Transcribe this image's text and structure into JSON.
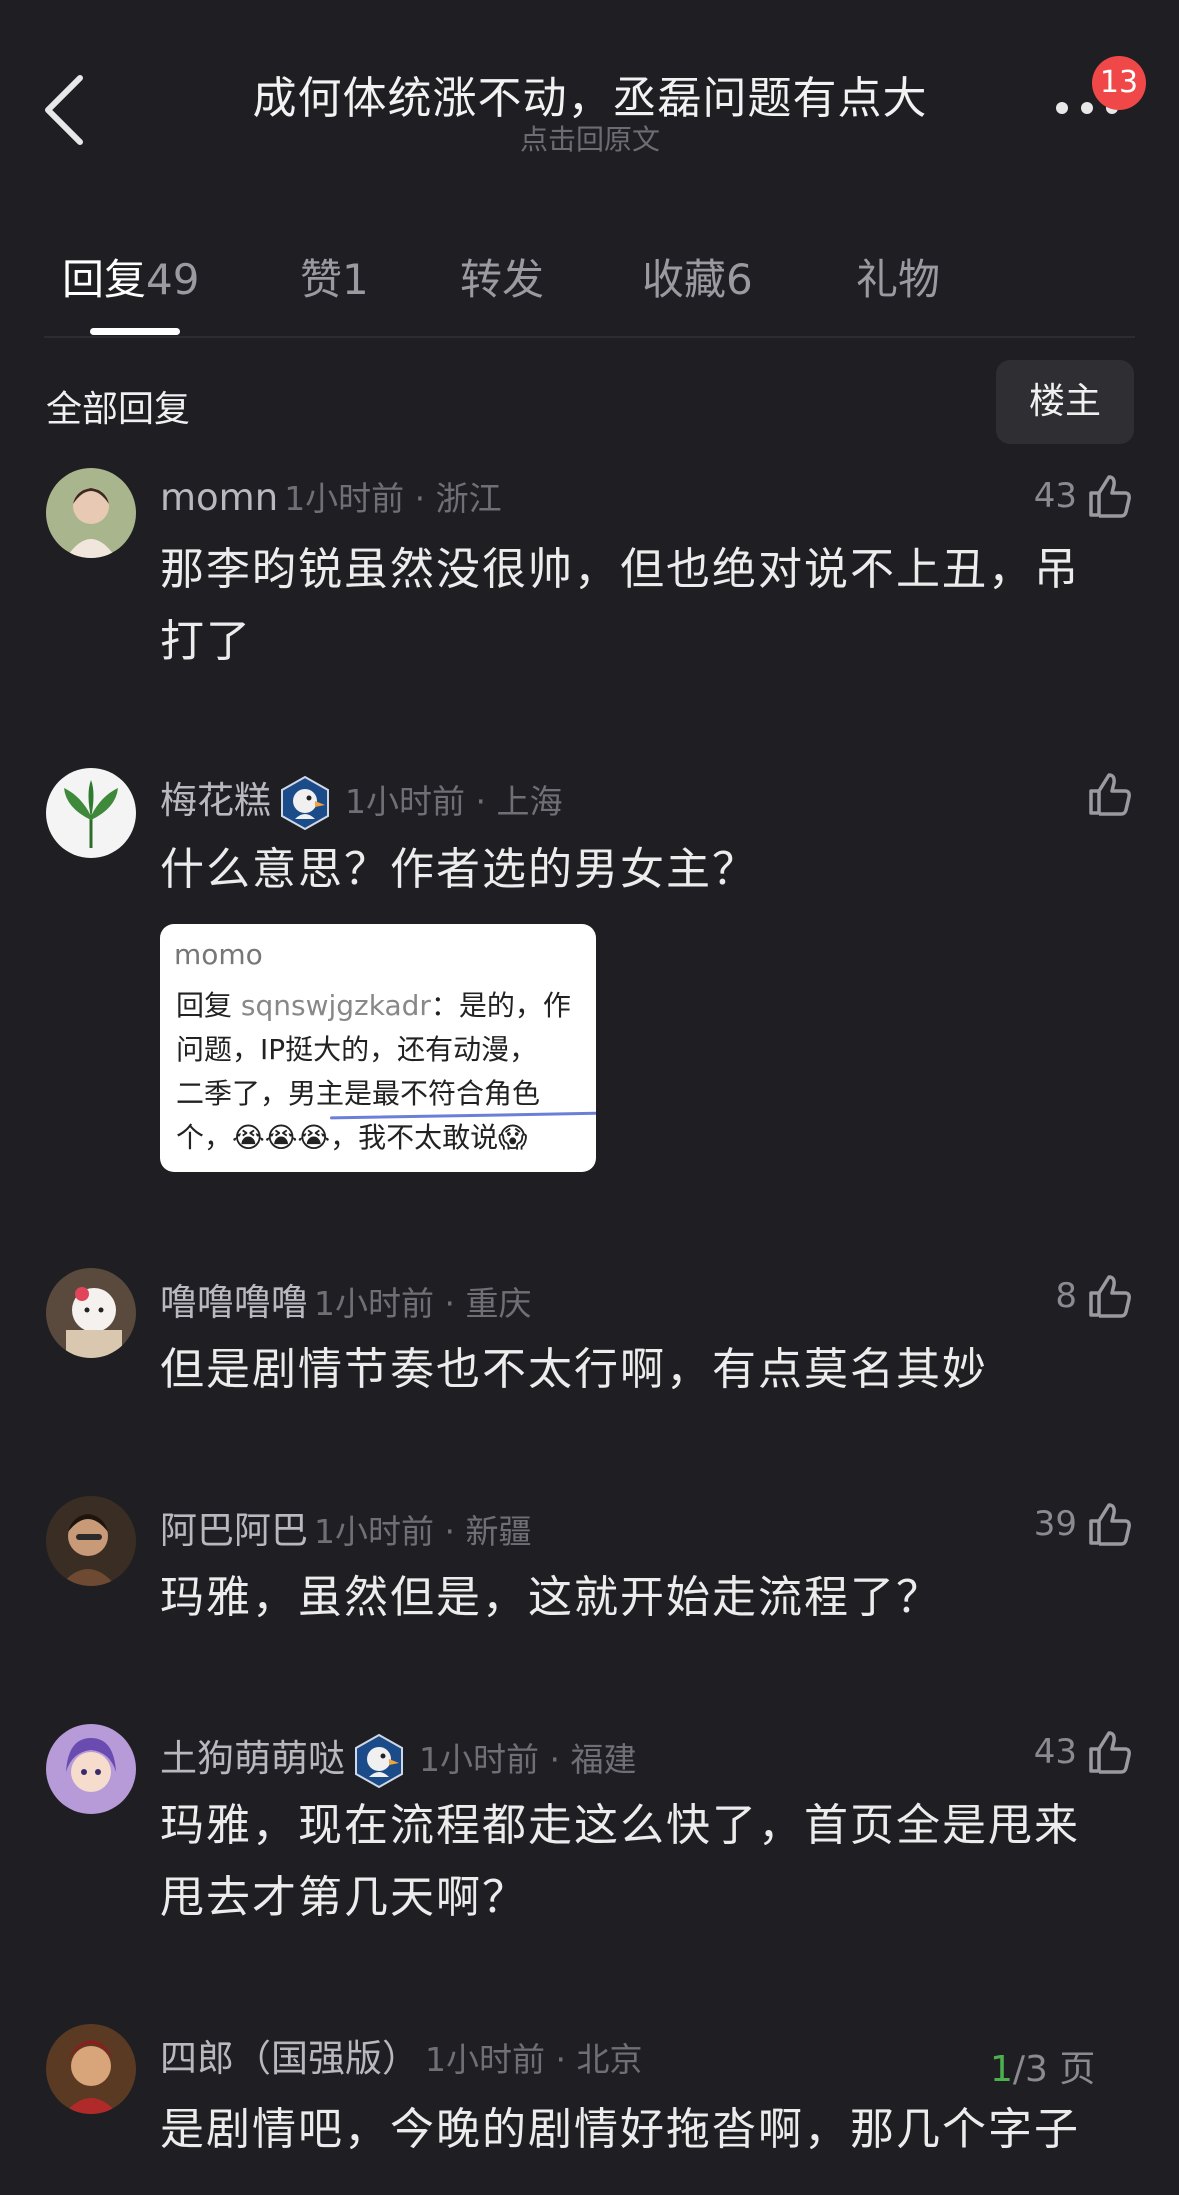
{
  "header": {
    "title": "成何体统涨不动，丞磊问题有点大",
    "subtitle": "点击回原文",
    "notification_count": "13"
  },
  "tabs": [
    {
      "label": "回复",
      "count": "49"
    },
    {
      "label": "赞",
      "count": "1"
    },
    {
      "label": "转发",
      "count": ""
    },
    {
      "label": "收藏",
      "count": "6"
    },
    {
      "label": "礼物",
      "count": ""
    }
  ],
  "filter": {
    "all_replies": "全部回复",
    "op_only": "楼主"
  },
  "comments": [
    {
      "username": "momn",
      "time": "1小时前 · 浙江",
      "likes": "43",
      "content": "那李昀锐虽然没很帅，但也绝对说不上丑，吊打了"
    },
    {
      "username": "梅花糕",
      "time": "1小时前 · 上海",
      "likes": "",
      "content": "什么意思？作者选的男女主？"
    },
    {
      "username": "噜噜噜噜",
      "time": "1小时前 · 重庆",
      "likes": "8",
      "content": "但是剧情节奏也不太行啊，有点莫名其妙"
    },
    {
      "username": "阿巴阿巴",
      "time": "1小时前 · 新疆",
      "likes": "39",
      "content": "玛雅，虽然但是，这就开始走流程了？"
    },
    {
      "username": "土狗萌萌哒",
      "time": "1小时前 · 福建",
      "likes": "43",
      "content": "玛雅，现在流程都走这么快了，首页全是甩来甩去才第几天啊？"
    },
    {
      "username": "四郎（国强版）",
      "time": "1小时前 · 北京",
      "likes": "",
      "content": "是剧情吧，今晚的剧情好拖沓啊，那几个字子"
    }
  ],
  "quote": {
    "name": "momo",
    "line1_prefix": "回复 ",
    "line1_handle": "sqnswjgzkadr",
    "line1_rest": "：是的，作",
    "line2": "问题，IP挺大的，还有动漫，",
    "line3": "二季了，男主是最不符合角色",
    "line4": "个，😭😭😭，我不太敢说😱"
  },
  "pagination": {
    "current": "1",
    "total": "/3 页"
  },
  "colors": {
    "background": "#1f1f23",
    "badge": "#f04848",
    "accent_green": "#4caf50"
  }
}
